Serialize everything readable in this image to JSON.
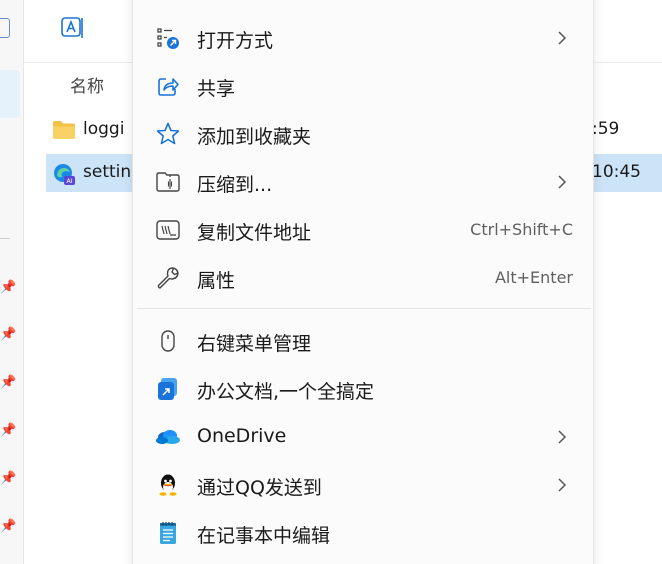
{
  "explorer": {
    "column_name": "名称",
    "files": [
      {
        "name": "loggi",
        "time": ":59",
        "icon": "folder-icon",
        "selected": false
      },
      {
        "name": "settin",
        "time": "10:45",
        "icon": "edge-ai-file-icon",
        "selected": true
      }
    ]
  },
  "context_menu": {
    "items": [
      {
        "label": "打开方式",
        "icon": "open-with-icon",
        "submenu": true
      },
      {
        "label": "共享",
        "icon": "share-icon",
        "submenu": false
      },
      {
        "label": "添加到收藏夹",
        "icon": "star-icon",
        "submenu": false
      },
      {
        "label": "压缩到...",
        "icon": "zip-folder-icon",
        "submenu": true
      },
      {
        "label": "复制文件地址",
        "icon": "copy-path-icon",
        "shortcut": "Ctrl+Shift+C"
      },
      {
        "label": "属性",
        "icon": "wrench-icon",
        "shortcut": "Alt+Enter"
      },
      {
        "label": "右键菜单管理",
        "icon": "mouse-icon",
        "submenu": false
      },
      {
        "label": "办公文档,一个全搞定",
        "icon": "office-doc-icon",
        "submenu": false
      },
      {
        "label": "OneDrive",
        "icon": "onedrive-icon",
        "submenu": true
      },
      {
        "label": "通过QQ发送到",
        "icon": "qq-icon",
        "submenu": true
      },
      {
        "label": "在记事本中编辑",
        "icon": "notepad-icon",
        "submenu": false
      }
    ]
  },
  "colors": {
    "selection": "#cce4f7",
    "menu_background": "#fbfbfb",
    "accent": "#1a73d9",
    "folder": "#f3c148"
  }
}
